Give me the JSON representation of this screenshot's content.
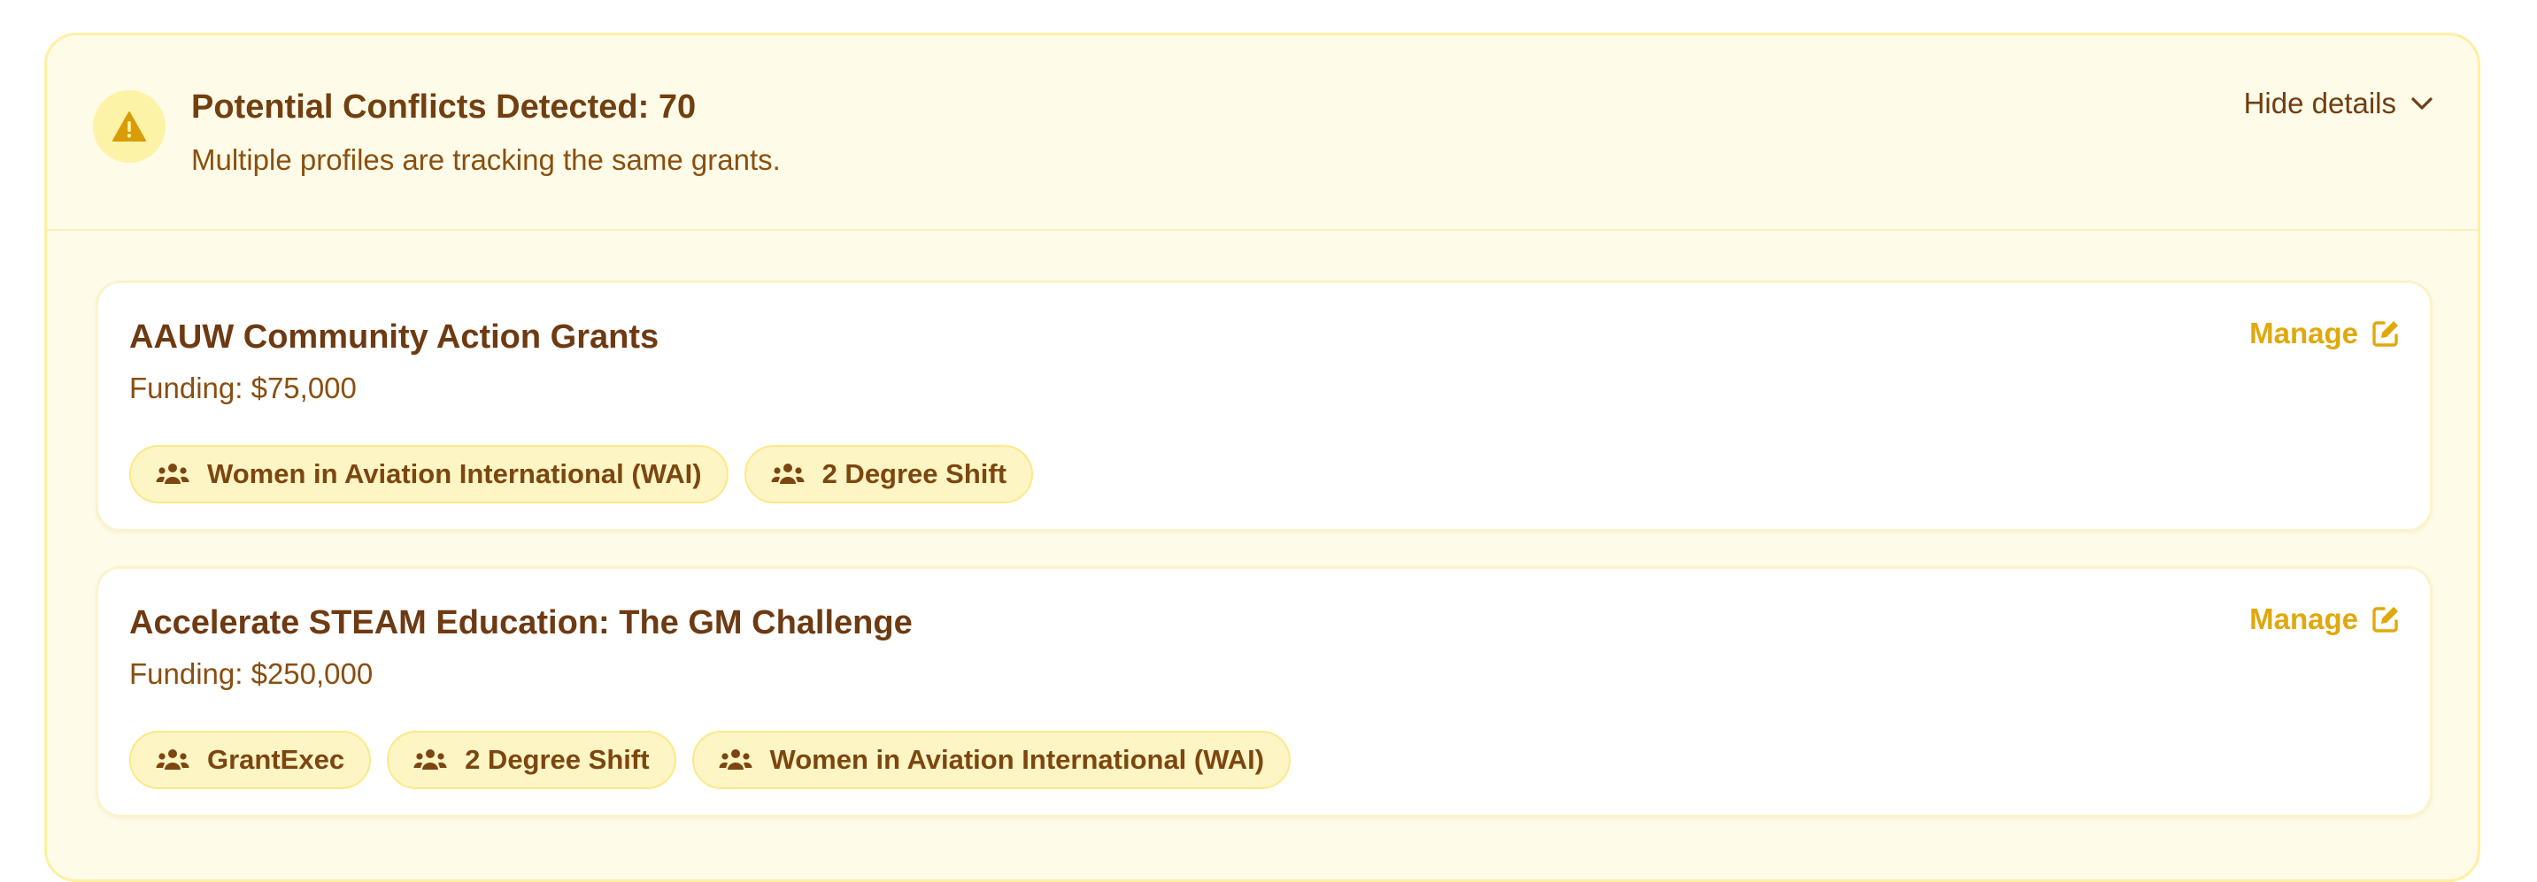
{
  "alert": {
    "icon": "warning-icon",
    "title": "Potential Conflicts Detected: 70",
    "subtitle": "Multiple profiles are tracking the same grants.",
    "toggle_label": "Hide details",
    "toggle_icon": "chevron-down-icon"
  },
  "grants": [
    {
      "title": "AAUW Community Action Grants",
      "funding": "Funding: $75,000",
      "manage_label": "Manage",
      "manage_icon": "edit-icon",
      "profiles": [
        "Women in Aviation International (WAI)",
        "2 Degree Shift"
      ]
    },
    {
      "title": "Accelerate STEAM Education: The GM Challenge",
      "funding": "Funding: $250,000",
      "manage_label": "Manage",
      "manage_icon": "edit-icon",
      "profiles": [
        "GrantExec",
        "2 Degree Shift",
        "Women in Aviation International (WAI)"
      ]
    }
  ],
  "colors": {
    "panel_bg": "#fefbe8",
    "panel_border": "#fdf0a3",
    "accent": "#e0a80a",
    "title_text": "#723f10",
    "tag_bg": "#fdf5c3"
  }
}
